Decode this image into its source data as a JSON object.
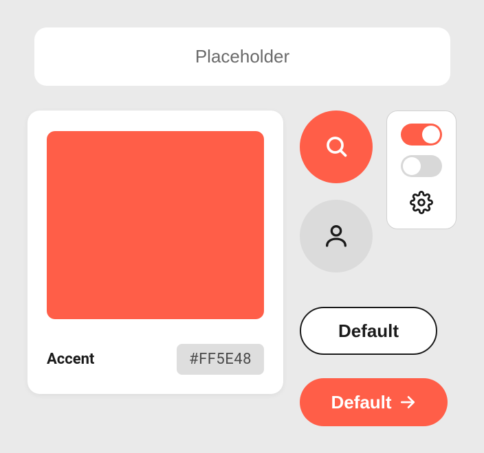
{
  "colors": {
    "accent": "#FF5E48",
    "gray_bg": "#eaeaea",
    "circle_gray": "#dbdbdb"
  },
  "input": {
    "placeholder": "Placeholder",
    "value": ""
  },
  "color_card": {
    "label": "Accent",
    "hex": "#FF5E48"
  },
  "icons": {
    "search": "search-icon",
    "user": "user-icon",
    "gear": "gear-icon",
    "arrow_right": "arrow-right-icon"
  },
  "toggles": {
    "toggle_on": true,
    "toggle_off": false
  },
  "buttons": {
    "default_outline": "Default",
    "default_filled": "Default"
  }
}
